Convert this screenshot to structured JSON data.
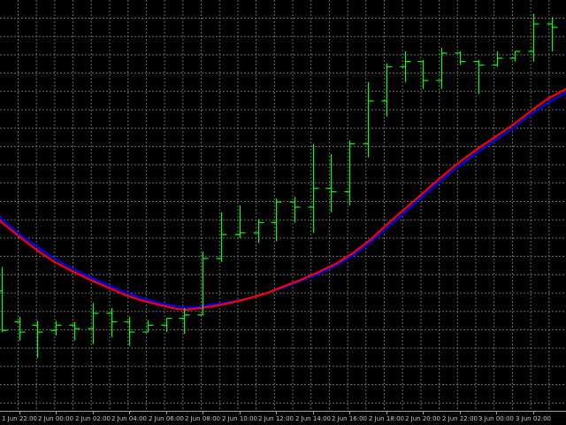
{
  "window": {
    "background": "#000000",
    "grid_color": "#6b6b6b",
    "axis_color": "#a0a0a0",
    "text_color": "#c8c8c8"
  },
  "chart_data": {
    "type": "ohlc",
    "grid": true,
    "ylim": [
      0,
      480
    ],
    "xlim": [
      0,
      640
    ],
    "x_tick_labels": [
      "1 Jun 22:00",
      "2 Jun 00:00",
      "2 Jun 02:00",
      "2 Jun 04:00",
      "2 Jun 06:00",
      "2 Jun 08:00",
      "2 Jun 10:00",
      "2 Jun 12:00",
      "2 Jun 14:00",
      "2 Jun 16:00",
      "2 Jun 18:00",
      "2 Jun 20:00",
      "2 Jun 22:00",
      "3 Jun 00:00",
      "3 Jun 02:00"
    ],
    "x_tick_positions": [
      22,
      63,
      105,
      146,
      188,
      229,
      271,
      312,
      354,
      395,
      437,
      478,
      520,
      561,
      603
    ],
    "bar_color": "#00ff00",
    "bars": [
      {
        "x": 2,
        "open": 140,
        "high": 168,
        "low": 92,
        "close": 94
      },
      {
        "x": 22,
        "open": 104,
        "high": 110,
        "low": 82,
        "close": 92
      },
      {
        "x": 42,
        "open": 100,
        "high": 105,
        "low": 62,
        "close": 92
      },
      {
        "x": 63,
        "open": 94,
        "high": 105,
        "low": 88,
        "close": 100
      },
      {
        "x": 84,
        "open": 100,
        "high": 104,
        "low": 82,
        "close": 96
      },
      {
        "x": 105,
        "open": 96,
        "high": 126,
        "low": 78,
        "close": 114
      },
      {
        "x": 126,
        "open": 114,
        "high": 120,
        "low": 86,
        "close": 104
      },
      {
        "x": 146,
        "open": 104,
        "high": 110,
        "low": 76,
        "close": 92
      },
      {
        "x": 167,
        "open": 92,
        "high": 106,
        "low": 92,
        "close": 100
      },
      {
        "x": 188,
        "open": 100,
        "high": 108,
        "low": 92,
        "close": 108
      },
      {
        "x": 208,
        "open": 108,
        "high": 120,
        "low": 90,
        "close": 112
      },
      {
        "x": 229,
        "open": 112,
        "high": 186,
        "low": 112,
        "close": 178
      },
      {
        "x": 250,
        "open": 178,
        "high": 232,
        "low": 174,
        "close": 206
      },
      {
        "x": 271,
        "open": 206,
        "high": 240,
        "low": 202,
        "close": 208
      },
      {
        "x": 292,
        "open": 208,
        "high": 224,
        "low": 196,
        "close": 220
      },
      {
        "x": 312,
        "open": 220,
        "high": 248,
        "low": 198,
        "close": 244
      },
      {
        "x": 333,
        "open": 244,
        "high": 250,
        "low": 220,
        "close": 238
      },
      {
        "x": 354,
        "open": 238,
        "high": 312,
        "low": 208,
        "close": 260
      },
      {
        "x": 374,
        "open": 260,
        "high": 300,
        "low": 232,
        "close": 256
      },
      {
        "x": 395,
        "open": 256,
        "high": 316,
        "low": 240,
        "close": 312
      },
      {
        "x": 416,
        "open": 312,
        "high": 384,
        "low": 296,
        "close": 362
      },
      {
        "x": 437,
        "open": 362,
        "high": 406,
        "low": 344,
        "close": 402
      },
      {
        "x": 458,
        "open": 402,
        "high": 420,
        "low": 384,
        "close": 408
      },
      {
        "x": 478,
        "open": 408,
        "high": 410,
        "low": 376,
        "close": 386
      },
      {
        "x": 499,
        "open": 386,
        "high": 424,
        "low": 376,
        "close": 418
      },
      {
        "x": 520,
        "open": 418,
        "high": 420,
        "low": 404,
        "close": 408
      },
      {
        "x": 541,
        "open": 408,
        "high": 410,
        "low": 370,
        "close": 404
      },
      {
        "x": 562,
        "open": 404,
        "high": 420,
        "low": 402,
        "close": 412
      },
      {
        "x": 582,
        "open": 412,
        "high": 420,
        "low": 408,
        "close": 420
      },
      {
        "x": 603,
        "open": 420,
        "high": 464,
        "low": 408,
        "close": 452
      },
      {
        "x": 624,
        "open": 452,
        "high": 460,
        "low": 420,
        "close": 448
      }
    ],
    "series": [
      {
        "color": "#0000ff",
        "points": [
          [
            0,
            226
          ],
          [
            20,
            208
          ],
          [
            40,
            193
          ],
          [
            60,
            179
          ],
          [
            80,
            167
          ],
          [
            100,
            157
          ],
          [
            120,
            148
          ],
          [
            140,
            139
          ],
          [
            160,
            132
          ],
          [
            180,
            126
          ],
          [
            200,
            122
          ],
          [
            210,
            120
          ],
          [
            220,
            121
          ],
          [
            240,
            124
          ],
          [
            260,
            127
          ],
          [
            280,
            131
          ],
          [
            300,
            137
          ],
          [
            320,
            144
          ],
          [
            340,
            152
          ],
          [
            360,
            160
          ],
          [
            380,
            170
          ],
          [
            400,
            182
          ],
          [
            420,
            198
          ],
          [
            440,
            216
          ],
          [
            460,
            234
          ],
          [
            480,
            252
          ],
          [
            500,
            270
          ],
          [
            520,
            287
          ],
          [
            540,
            302
          ],
          [
            560,
            316
          ],
          [
            580,
            330
          ],
          [
            600,
            346
          ],
          [
            620,
            360
          ],
          [
            640,
            372
          ]
        ]
      },
      {
        "color": "#ff0000",
        "points": [
          [
            0,
            222
          ],
          [
            20,
            205
          ],
          [
            40,
            189
          ],
          [
            60,
            175
          ],
          [
            80,
            164
          ],
          [
            100,
            154
          ],
          [
            120,
            145
          ],
          [
            140,
            136
          ],
          [
            160,
            129
          ],
          [
            180,
            124
          ],
          [
            200,
            119
          ],
          [
            210,
            118
          ],
          [
            220,
            119
          ],
          [
            240,
            122
          ],
          [
            260,
            126
          ],
          [
            280,
            131
          ],
          [
            300,
            137
          ],
          [
            320,
            145
          ],
          [
            340,
            153
          ],
          [
            360,
            162
          ],
          [
            380,
            172
          ],
          [
            400,
            185
          ],
          [
            420,
            201
          ],
          [
            440,
            220
          ],
          [
            460,
            238
          ],
          [
            480,
            256
          ],
          [
            500,
            274
          ],
          [
            520,
            291
          ],
          [
            540,
            306
          ],
          [
            560,
            320
          ],
          [
            580,
            334
          ],
          [
            600,
            350
          ],
          [
            620,
            365
          ],
          [
            640,
            376
          ]
        ]
      }
    ]
  }
}
